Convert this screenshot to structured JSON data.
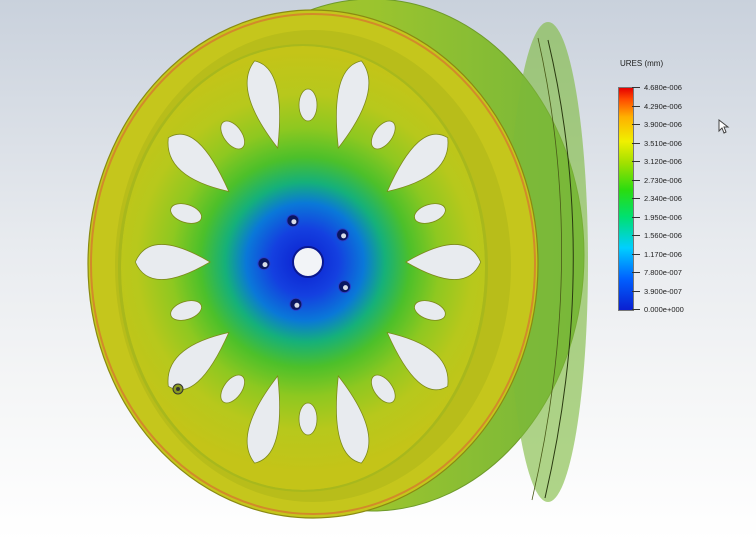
{
  "legend": {
    "title": "URES (mm)",
    "labels": [
      "4.680e-006",
      "4.290e-006",
      "3.900e-006",
      "3.510e-006",
      "3.120e-006",
      "2.730e-006",
      "2.340e-006",
      "1.950e-006",
      "1.560e-006",
      "1.170e-006",
      "7.800e-007",
      "3.900e-007",
      "0.000e+000"
    ],
    "colors": [
      "#e60000",
      "#ff4a00",
      "#ff8c00",
      "#ffcc00",
      "#f0f000",
      "#a0e000",
      "#2adc10",
      "#00d050",
      "#00e0a0",
      "#00cfff",
      "#0090ff",
      "#0050f0",
      "#0a1fd0"
    ]
  },
  "model": {
    "spoke_count": 10,
    "lug_holes": 5
  }
}
